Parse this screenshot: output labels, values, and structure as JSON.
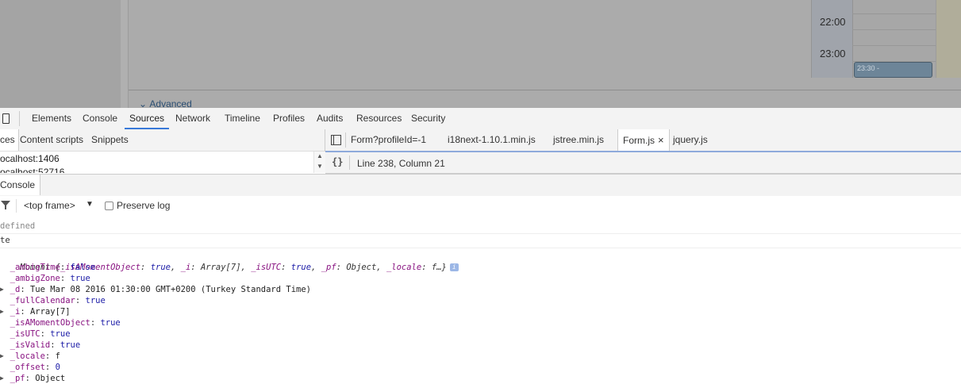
{
  "page_area": {
    "advanced_label": "Advanced",
    "calendar": {
      "times": [
        "22:00",
        "23:00"
      ],
      "event_text": "23:30 -"
    }
  },
  "devtools": {
    "tabs": [
      "Elements",
      "Console",
      "Sources",
      "Network",
      "Timeline",
      "Profiles",
      "Audits",
      "Resources",
      "Security"
    ],
    "active_tab": "Sources",
    "navigator_tabs": [
      "ces",
      "Content scripts",
      "Snippets"
    ],
    "navigator_items": [
      "ocalhost:1406",
      "ocalhost:52716"
    ],
    "editor_tabs": [
      "Form?profileId=-1",
      "i18next-1.10.1.min.js",
      "jstree.min.js",
      "Form.js",
      "jquery.js"
    ],
    "active_editor_tab": "Form.js",
    "status": "Line 238, Column 21",
    "drawer_tab": "Console",
    "frame_select": "<top frame>",
    "preserve_log_label": "Preserve log",
    "preserve_log_checked": false
  },
  "console": {
    "line_undefined": "defined",
    "line_te": "te",
    "moment_summary_prefix": "Moment {",
    "moment_summary": [
      {
        "key": "_isAMomentObject",
        "value": "true"
      },
      {
        "key": "_i",
        "value": "Array[7]"
      },
      {
        "key": "_isUTC",
        "value": "true"
      },
      {
        "key": "_pf",
        "value": "Object"
      },
      {
        "key": "_locale",
        "value": "f…}"
      }
    ],
    "props": [
      {
        "key": "_ambigTime",
        "value": "false",
        "expandable": false
      },
      {
        "key": "_ambigZone",
        "value": "true",
        "expandable": false
      },
      {
        "key": "_d",
        "value": "Tue Mar 08 2016 01:30:00 GMT+0200 (Turkey Standard Time)",
        "expandable": true
      },
      {
        "key": "_fullCalendar",
        "value": "true",
        "expandable": false
      },
      {
        "key": "_i",
        "value": "Array[7]",
        "expandable": true
      },
      {
        "key": "_isAMomentObject",
        "value": "true",
        "expandable": false
      },
      {
        "key": "_isUTC",
        "value": "true",
        "expandable": false
      },
      {
        "key": "_isValid",
        "value": "true",
        "expandable": false
      },
      {
        "key": "_locale",
        "value": "f",
        "expandable": true
      },
      {
        "key": "_offset",
        "value": "0",
        "expandable": false
      },
      {
        "key": "_pf",
        "value": "Object",
        "expandable": true
      }
    ]
  }
}
